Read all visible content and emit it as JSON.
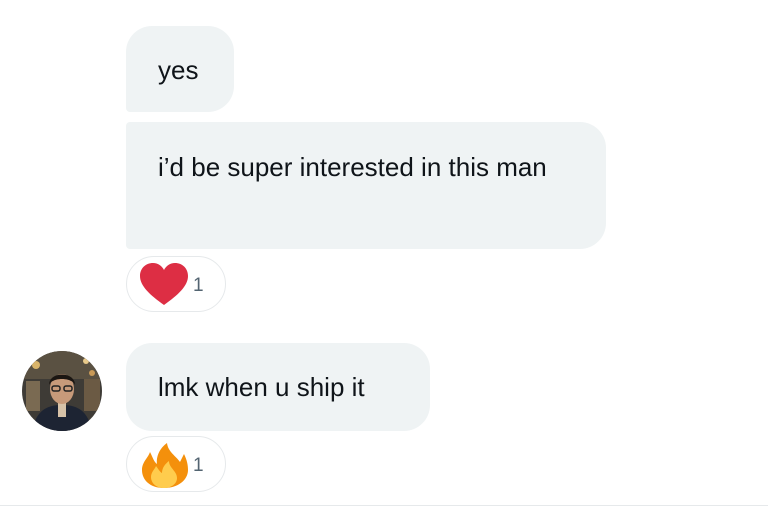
{
  "messages": [
    {
      "text": "yes"
    },
    {
      "text": "i’d be super interested in this man",
      "reaction": {
        "icon": "heart-icon",
        "count": "1"
      }
    },
    {
      "text": "lmk when u ship it",
      "reaction": {
        "icon": "fire-icon",
        "count": "1"
      }
    }
  ],
  "colors": {
    "bubble_bg": "#eff3f4",
    "text": "#0f1419",
    "count_text": "#536471",
    "heart": "#dd2e44",
    "fire": "#f4900c"
  }
}
